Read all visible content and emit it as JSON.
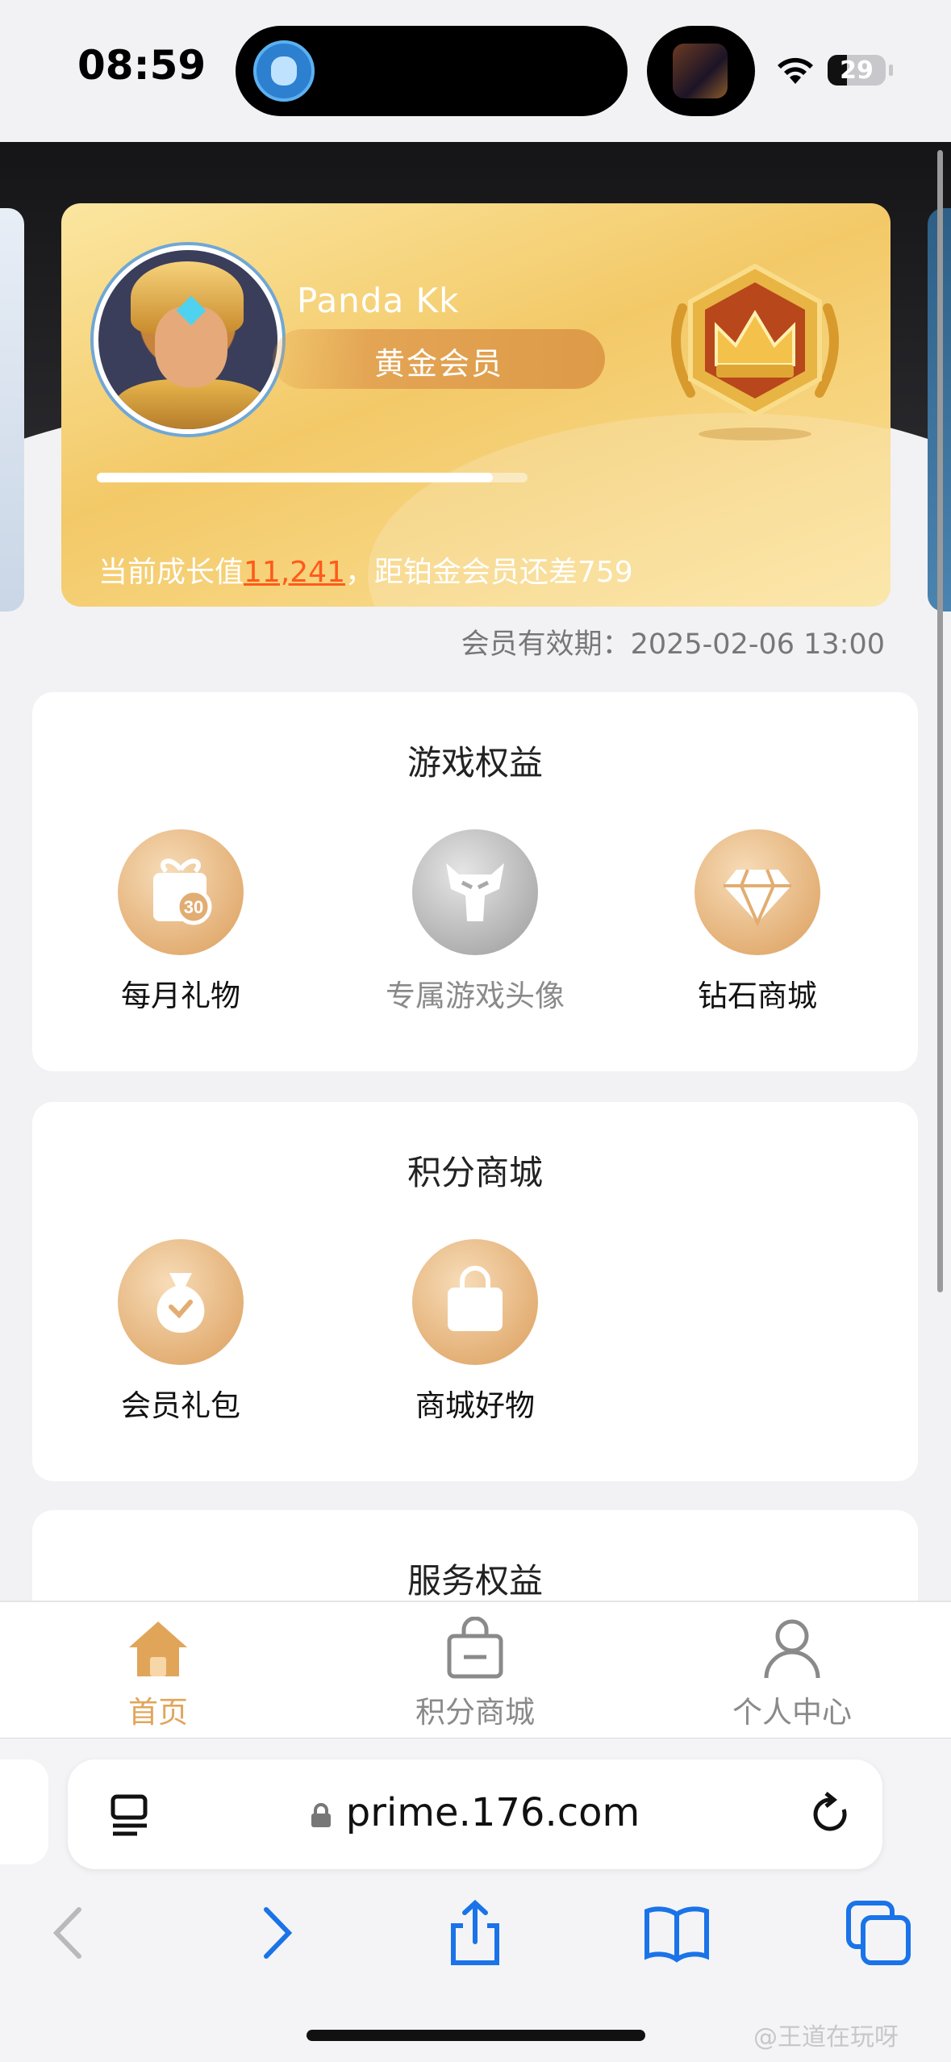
{
  "status_bar": {
    "time": "08:59",
    "battery": "29"
  },
  "member_card": {
    "username": "Panda Kk",
    "level": "黄金会员",
    "progress_fraction": 0.92,
    "growth_prefix": "当前成长值",
    "growth_value": "11,241",
    "growth_suffix": "，距铂金会员还差759"
  },
  "expiry": "会员有效期：2025-02-06 13:00",
  "sections": {
    "game_benefits": {
      "title": "游戏权益",
      "items": [
        {
          "label": "每月礼物",
          "icon": "gift-30-icon"
        },
        {
          "label": "专属游戏头像",
          "icon": "warrior-mask-icon"
        },
        {
          "label": "钻石商城",
          "icon": "diamond-icon"
        }
      ]
    },
    "points_mall": {
      "title": "积分商城",
      "items": [
        {
          "label": "会员礼包",
          "icon": "money-bag-icon"
        },
        {
          "label": "商城好物",
          "icon": "shopping-bag-icon"
        }
      ]
    },
    "services": {
      "title": "服务权益"
    }
  },
  "tab_bar": {
    "tabs": [
      {
        "label": "首页",
        "icon": "home-icon",
        "active": true
      },
      {
        "label": "积分商城",
        "icon": "shopping-bag-icon",
        "active": false
      },
      {
        "label": "个人中心",
        "icon": "person-icon",
        "active": false
      }
    ]
  },
  "browser": {
    "url": "prime.176.com"
  },
  "watermark": "@王道在玩呀",
  "colors": {
    "gold": "#e1a55a",
    "link_orange": "#ff5a1a",
    "ios_blue": "#1a73e8"
  }
}
